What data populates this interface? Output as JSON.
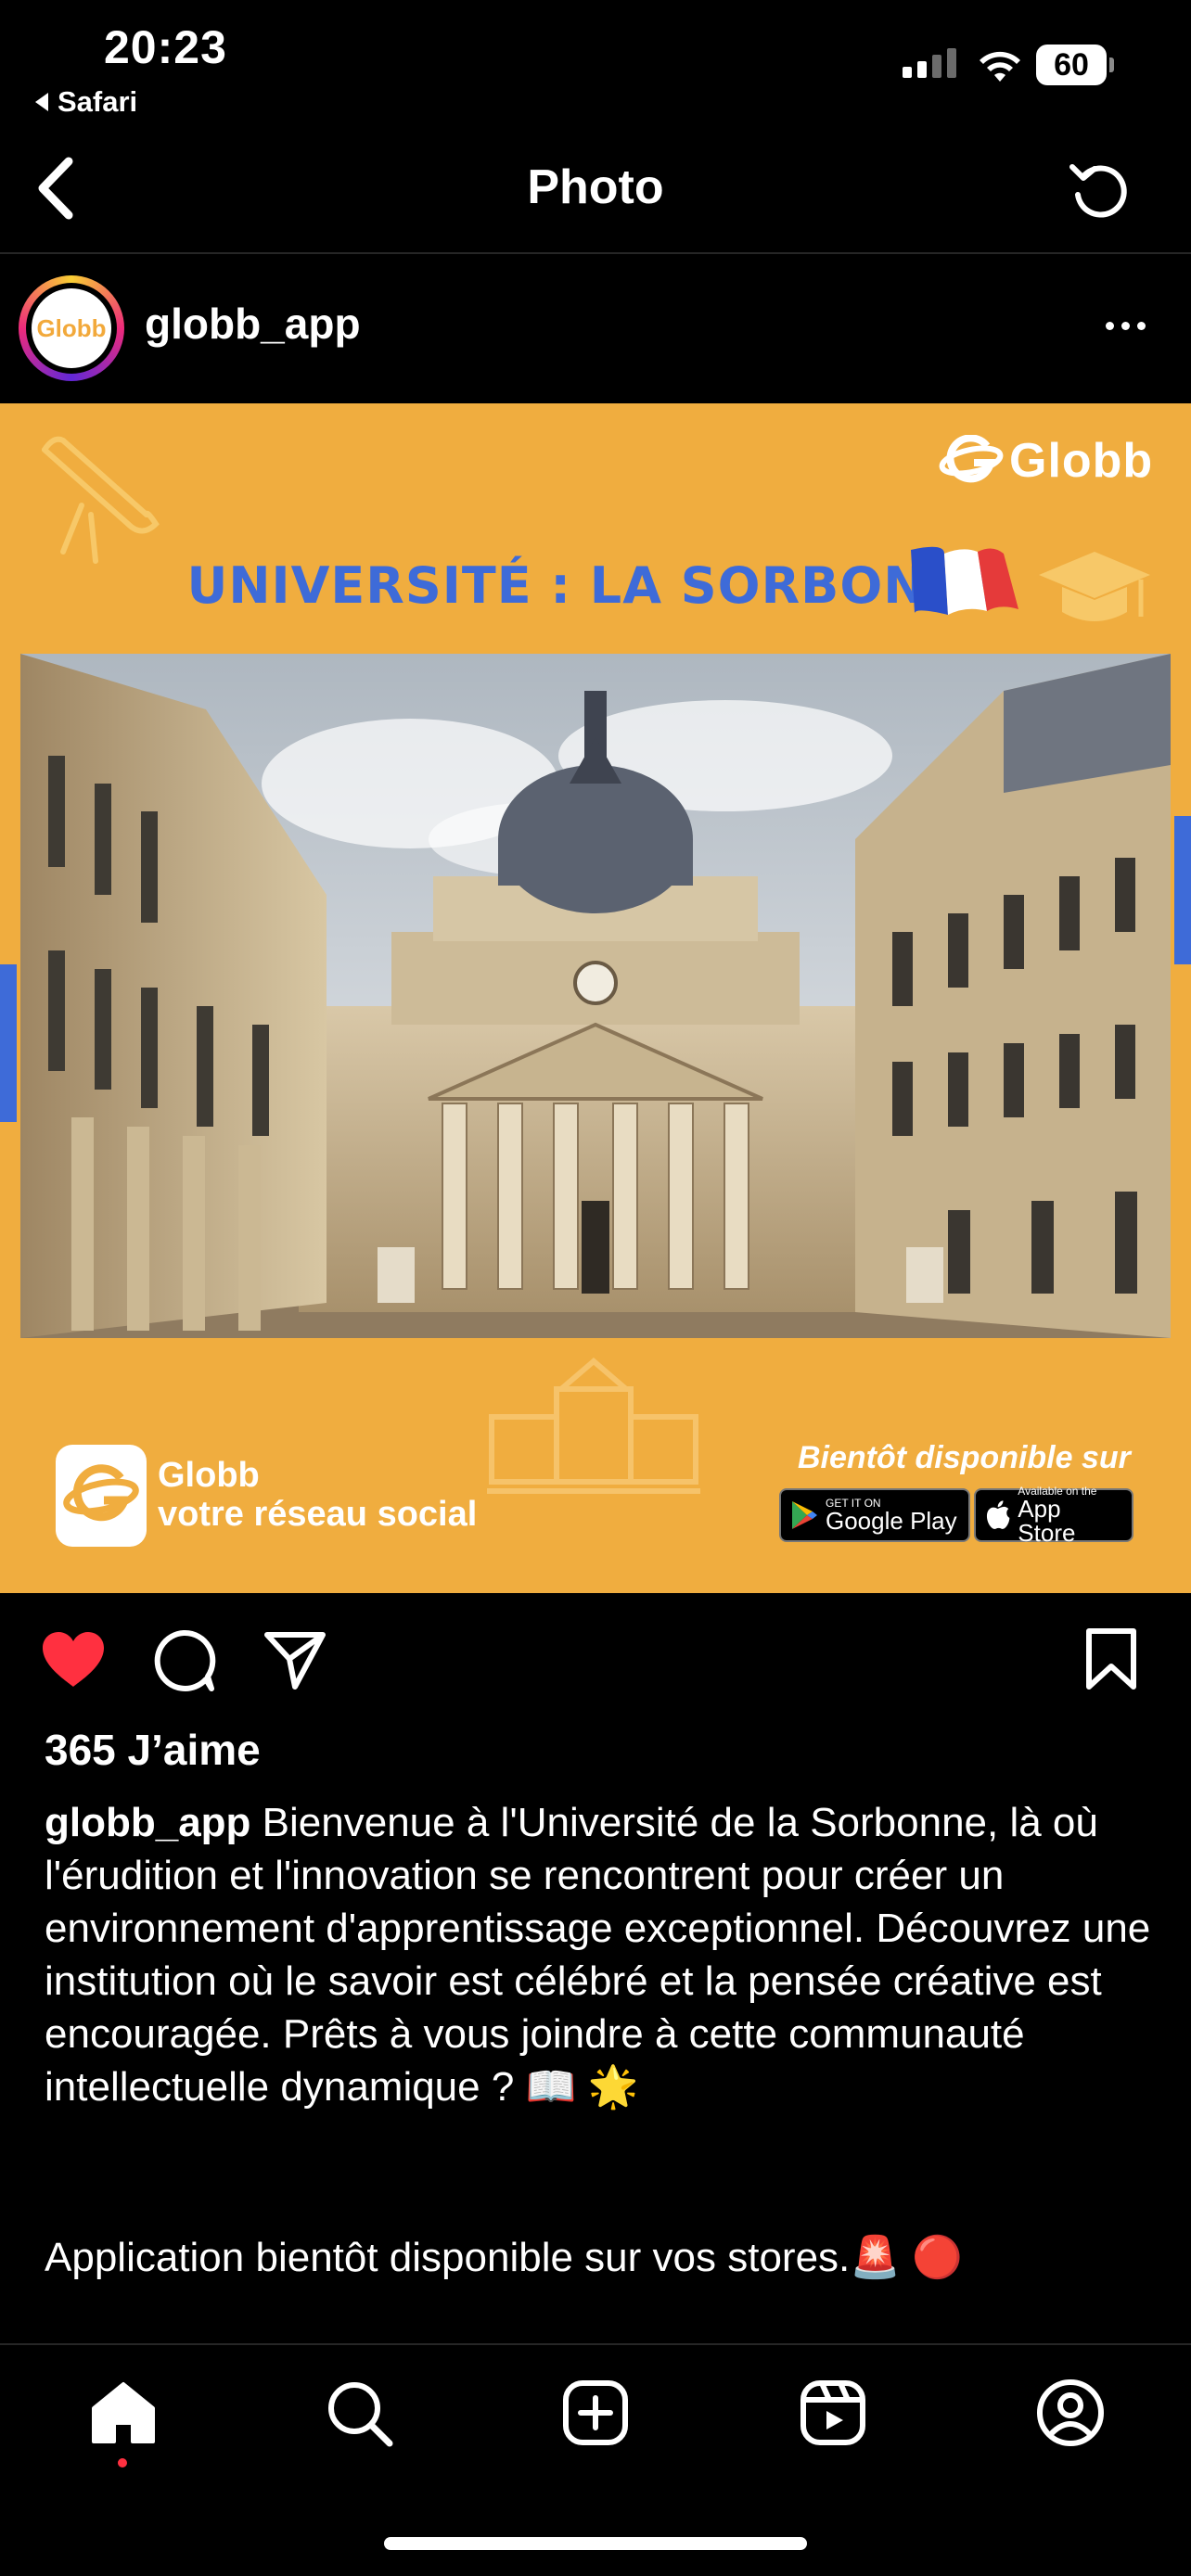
{
  "status_bar": {
    "time": "20:23",
    "back_app": "Safari",
    "battery": "60"
  },
  "nav": {
    "title": "Photo"
  },
  "post": {
    "username": "globb_app",
    "avatar_text": "Globb",
    "image": {
      "brand": "Globb",
      "headline": "UNIVERSITÉ : LA SORBONNE",
      "footer_brand": "Globb",
      "footer_tagline": "votre réseau social",
      "availability": "Bientôt disponible sur",
      "google_play_small": "GET IT ON",
      "google_play_big": "Google Play",
      "app_store_small": "Available on the",
      "app_store_big": "App Store",
      "colors": {
        "background": "#f0ad3f",
        "headline": "#3e6bd8"
      }
    },
    "likes": "365 J’aime",
    "caption_user": "globb_app",
    "caption_text": "Bienvenue à l'Université de la Sorbonne, là où l'érudition et l'innovation se rencontrent pour créer un environnement d'apprentissage exceptionnel. Découvrez une institution où le savoir est célébré et la pensée créative est encouragée. Prêts à vous joindre à cette communauté intellectuelle dynamique ? 📖 🌟",
    "caption_text2": "Application bientôt disponible sur vos stores.🚨 🔴",
    "liked": true
  },
  "tabbar": {
    "items": [
      {
        "icon": "home-icon",
        "active": true
      },
      {
        "icon": "search-icon"
      },
      {
        "icon": "create-icon"
      },
      {
        "icon": "reels-icon"
      },
      {
        "icon": "profile-icon"
      }
    ]
  }
}
